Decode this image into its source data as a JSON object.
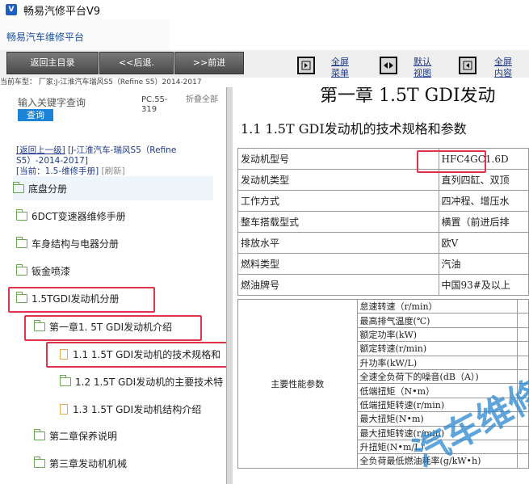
{
  "window": {
    "title": "畅易汽修平台V9",
    "icon": "app-logo"
  },
  "header": {
    "subtitle": "畅易汽车维修平台"
  },
  "toolbar": {
    "back_home": "返回主目录",
    "prev": "<<后退.",
    "next": ">>前进",
    "fullscreen_menu": [
      "全屏",
      "菜单"
    ],
    "default_view": [
      "默认",
      "视图"
    ],
    "fullscreen_content": [
      "全屏",
      "内容"
    ]
  },
  "vehicle": {
    "line": "当前车型： 厂家:J-江淮汽车瑞风S5（Refine S5）2014-2017"
  },
  "sidebar": {
    "search_placeholder": "输入关键字查询",
    "search_button": "查询",
    "code": "PC.55-319",
    "fold_all": "折叠全部",
    "back_up": "[返回上一级]",
    "back_path": "[J-江淮汽车-瑞风S5（Refine S5）-2014-2017]",
    "current": "[当前：1.5-维修手册]",
    "refresh": "[刷新]",
    "items": [
      {
        "label": "底盘分册"
      },
      {
        "label": "6DCT变速器维修手册"
      },
      {
        "label": "车身结构与电器分册"
      },
      {
        "label": "钣金喷漆"
      },
      {
        "label": "1.5TGDI发动机分册"
      },
      {
        "label": "第一章1. 5T GDI发动机介绍"
      },
      {
        "label": "1.1 1.5T GDI发动机的技术规格和"
      },
      {
        "label": "1.2 1.5T GDI发动机的主要技术特"
      },
      {
        "label": "1.3 1.5T GDI发动机结构介绍"
      },
      {
        "label": "第二章保养说明"
      },
      {
        "label": "第三章发动机机械"
      }
    ]
  },
  "content": {
    "chapter_title": "第一章 1.5T GDI发动",
    "section_title": "1.1 1.5T GDI发动机的技术规格和参数",
    "spec_rows": [
      {
        "label": "发动机型号",
        "value": "HFC4GC1.6D"
      },
      {
        "label": "发动机类型",
        "value": "直列四缸、双顶"
      },
      {
        "label": "工作方式",
        "value": "四冲程、增压水"
      },
      {
        "label": "整车搭载型式",
        "value": "横置（前进后排"
      },
      {
        "label": "排放水平",
        "value": "欧V"
      },
      {
        "label": "燃料类型",
        "value": "汽油"
      },
      {
        "label": "燃油牌号",
        "value": "中国93#及以上"
      }
    ],
    "perf_group": "主要性能参数",
    "perf_rows": [
      "怠速转速（r/min）",
      "最高排气温度(℃)",
      "额定功率(kW)",
      "额定转速(r/min)",
      "升功率(kW/L)",
      "全速全负荷下的噪音(dB（A）)",
      "低端扭矩（N•m）",
      "低端扭矩转速(r/min)",
      "最大扭矩(N•m)",
      "最大扭矩转速(r/min)",
      "升扭矩(N•m/L)",
      "全负荷最低燃油耗率(g/kW•h)"
    ],
    "watermark": "汽车维修"
  },
  "colors": {
    "highlight": "#e0344a",
    "link": "#1e3a8a",
    "folder": "#6aa84f",
    "doc": "#e8a94d",
    "search_button": "#1c83d8"
  }
}
